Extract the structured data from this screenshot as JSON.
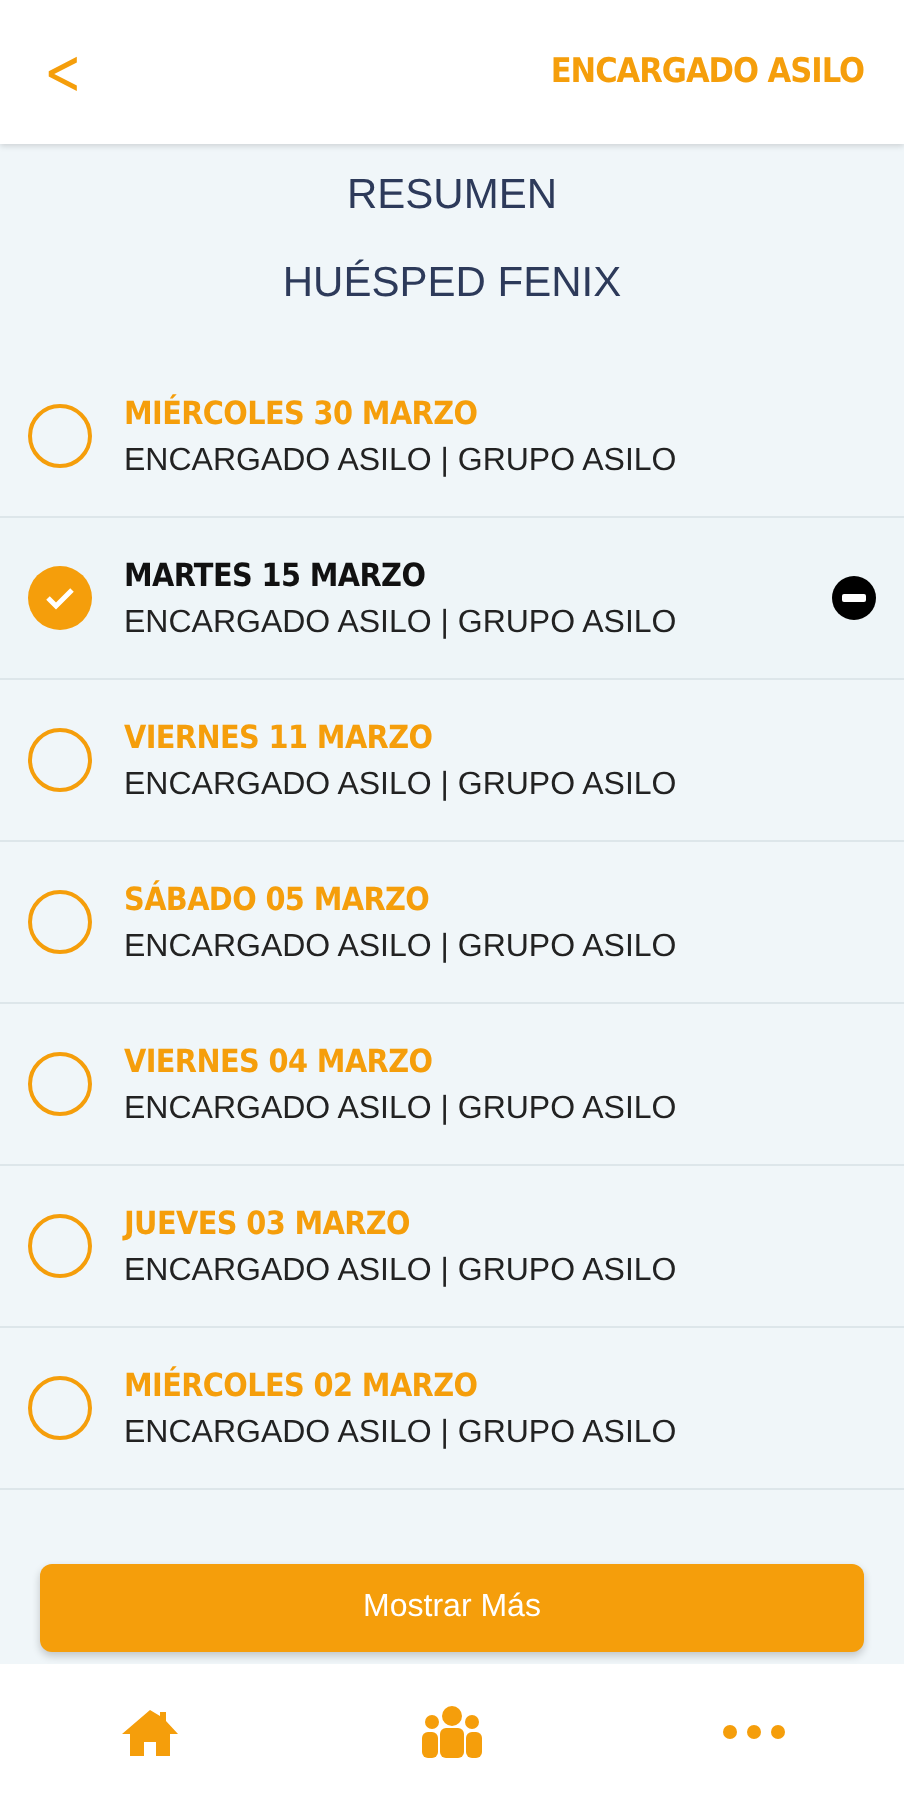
{
  "header": {
    "back": "<",
    "title": "ENCARGADO ASILO"
  },
  "summary": {
    "title": "RESUMEN",
    "guest": "HUÉSPED FENIX"
  },
  "entries": [
    {
      "date": "MIÉRCOLES 30 MARZO",
      "detail": "ENCARGADO ASILO | GRUPO ASILO",
      "selected": false
    },
    {
      "date": "MARTES 15 MARZO",
      "detail": "ENCARGADO ASILO | GRUPO ASILO",
      "selected": true
    },
    {
      "date": "VIERNES 11 MARZO",
      "detail": "ENCARGADO ASILO | GRUPO ASILO",
      "selected": false
    },
    {
      "date": "SÁBADO 05 MARZO",
      "detail": "ENCARGADO ASILO | GRUPO ASILO",
      "selected": false
    },
    {
      "date": "VIERNES 04 MARZO",
      "detail": "ENCARGADO ASILO | GRUPO ASILO",
      "selected": false
    },
    {
      "date": "JUEVES 03 MARZO",
      "detail": "ENCARGADO ASILO | GRUPO ASILO",
      "selected": false
    },
    {
      "date": "MIÉRCOLES 02 MARZO",
      "detail": "ENCARGADO ASILO | GRUPO ASILO",
      "selected": false
    }
  ],
  "more_button": "Mostrar Más",
  "tabs": [
    {
      "kind": "home"
    },
    {
      "kind": "group"
    },
    {
      "kind": "more"
    }
  ]
}
